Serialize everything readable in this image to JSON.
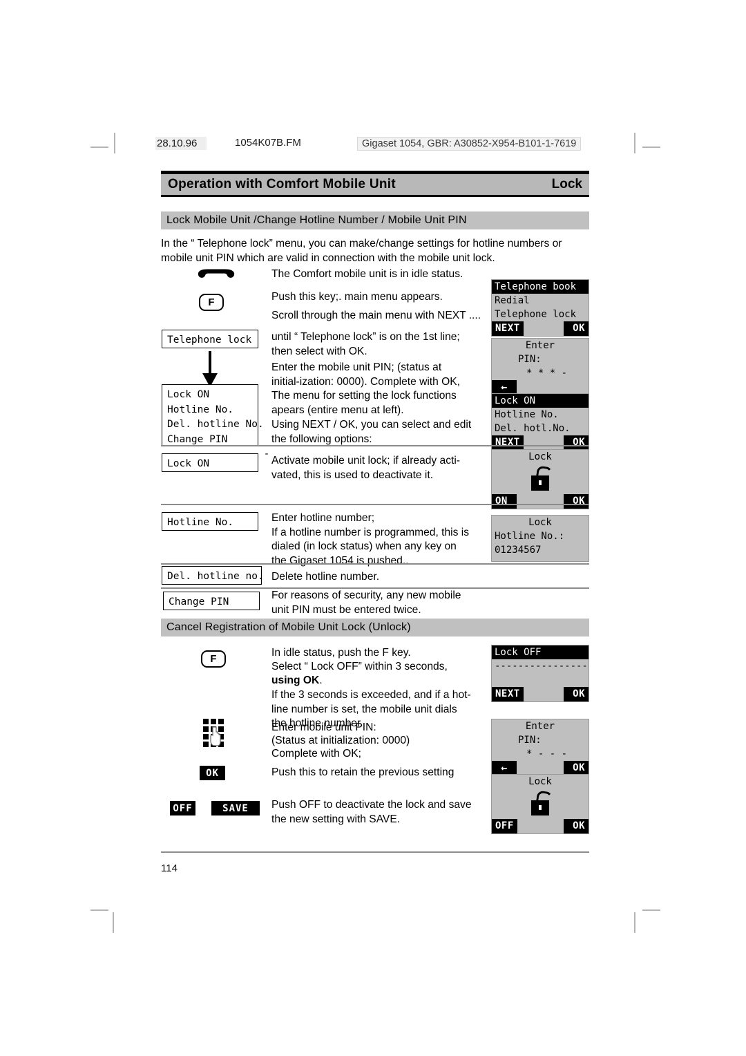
{
  "meta": {
    "date": "28.10.96",
    "filename": "1054K07B.FM",
    "identifier": "Gigaset 1054, GBR: A30852-X954-B101-1-7619"
  },
  "running_head": {
    "left": "Operation with Comfort Mobile Unit",
    "right": "Lock"
  },
  "sections": {
    "first": "Lock Mobile Unit /Change Hotline Number / Mobile Unit PIN",
    "second": "Cancel Registration of Mobile Unit Lock (Unlock)"
  },
  "intro": "In the “ Telephone lock”  menu, you can make/change settings for hotline numbers or mobile unit PIN which are valid in connection with the mobile unit lock.",
  "steps": {
    "idle": "The Comfort mobile unit is in idle status.",
    "push_key": "Push this key;. main menu appears.",
    "scroll": "Scroll through the main menu with NEXT ....",
    "until_first_line": "until “ Telephone lock”  is on the 1st line; then select with OK.",
    "enter_pin": "Enter the mobile unit PIN; (status at initial-ization: 0000). Complete with OK,",
    "menu_appears": "The menu for setting the lock functions apears (entire menu at left).",
    "using_next_ok": "Using NEXT / OK, you can select and edit the following options:",
    "lock_on_desc": "Activate mobile unit lock; if already acti-vated, this is used to deactivate it.",
    "hotline_desc": "Enter hotline number;\nIf a hotline number is programmed, this is dialed (in lock status) when any key on the Gigaset 1054 is pushed..",
    "del_hotline_desc": "Delete hotline number.",
    "change_pin_desc": "For reasons of security, any new mobile unit PIN must be entered twice.",
    "unlock_idle_1": "In idle status, push the F key.",
    "unlock_idle_2": "Select “ Lock OFF”  within 3 seconds,",
    "unlock_using_ok": "using OK",
    "unlock_using_ok_tail": ".",
    "unlock_timeout": "If the 3 seconds is exceeded, and  if a hot-line number is set, the mobile unit dials the hotline number.",
    "unlock_pin_1": "Enter mobile unit PIN:",
    "unlock_pin_2": "(Status at initialization: 0000)",
    "unlock_pin_3": "Complete with OK;",
    "retain": "Push this to retain the previous setting",
    "off_save": "Push OFF to deactivate the lock and save the new setting with SAVE."
  },
  "keys": {
    "f_label": "F",
    "ok_chip": "OK",
    "off_chip": "OFF",
    "save_chip": "SAVE"
  },
  "left_boxes": {
    "telephone_lock": "Telephone lock",
    "menu_list": "Lock ON\nHotline No.\nDel. hotline No.\nChange PIN\n- - - - - - - - -",
    "lock_on": "Lock ON",
    "hotline_no": "Hotline No.",
    "del_hotline_no": "Del. hotline no.",
    "change_pin": "Change PIN"
  },
  "displays": {
    "main_menu": {
      "title": "Telephone book",
      "line1": "Redial",
      "line2": "Telephone lock",
      "soft_left": "NEXT",
      "soft_right": "OK"
    },
    "enter_pin_1": {
      "line1": "Enter",
      "line2": "PIN:",
      "line3": "* * * -",
      "soft_left": "←",
      "soft_right": ""
    },
    "lock_menu": {
      "title": "Lock ON",
      "line1": "Hotline No.",
      "line2": "Del. hotl.No.",
      "soft_left": "NEXT",
      "soft_right": "OK"
    },
    "lock_toggle": {
      "title": "Lock",
      "soft_left": "ON",
      "soft_right": "OK"
    },
    "hotline_display": {
      "line1": "Lock",
      "line2": "Hotline No.:",
      "line3": "01234567"
    },
    "lock_off": {
      "title": "Lock OFF",
      "line1": "----------------",
      "soft_left": "NEXT",
      "soft_right": "OK"
    },
    "enter_pin_2": {
      "line1": "Enter",
      "line2": "PIN:",
      "line3": "* - - -",
      "soft_left": "←",
      "soft_right": "OK"
    },
    "lock_unlock": {
      "title": "Lock",
      "soft_left": "OFF",
      "soft_right": "OK"
    }
  },
  "footer": {
    "page_number": "114"
  }
}
